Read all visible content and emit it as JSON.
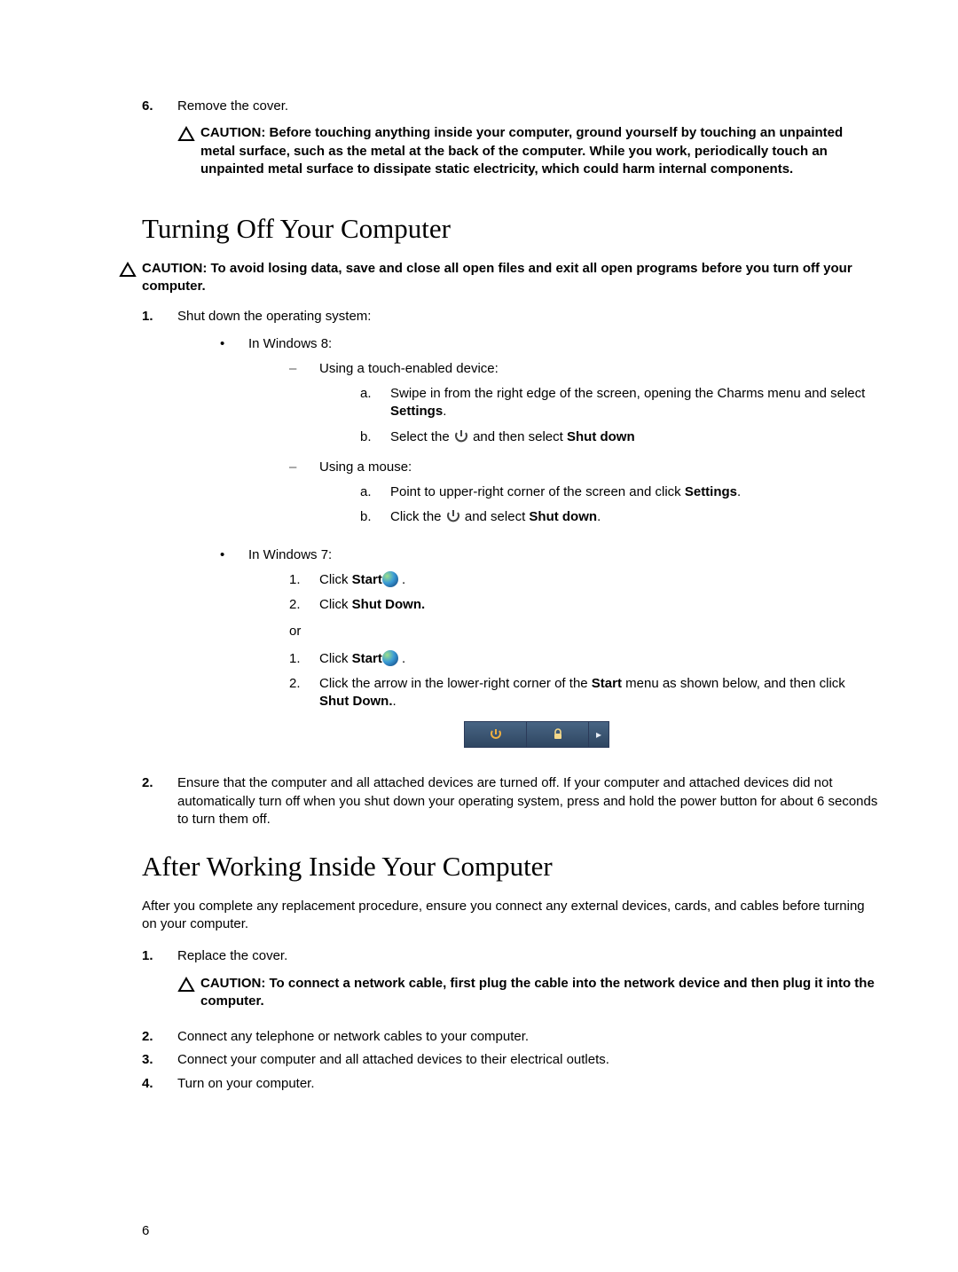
{
  "step6": {
    "num": "6.",
    "text": "Remove the cover.",
    "caution": "CAUTION: Before touching anything inside your computer, ground yourself by touching an unpainted metal surface, such as the metal at the back of the computer. While you work, periodically touch an unpainted metal surface to dissipate static electricity, which could harm internal components."
  },
  "section1": {
    "heading": "Turning Off Your Computer",
    "top_caution": "CAUTION: To avoid losing data, save and close all open files and exit all open programs before you turn off your computer.",
    "step1_num": "1.",
    "step1_text": "Shut down the operating system:",
    "win8_label": "In Windows 8:",
    "touch_label": "Using a touch-enabled device:",
    "touch_a_pre": "Swipe in from the right edge of the screen, opening the Charms menu and select ",
    "touch_a_bold": "Settings",
    "touch_a_post": ".",
    "touch_b_pre": "Select the ",
    "touch_b_mid": " and then select ",
    "touch_b_bold": "Shut down",
    "mouse_label": "Using a mouse:",
    "mouse_a_pre": "Point to upper-right corner of the screen and click ",
    "mouse_a_bold": "Settings",
    "mouse_a_post": ".",
    "mouse_b_pre": "Click the ",
    "mouse_b_mid": " and select ",
    "mouse_b_bold": "Shut down",
    "mouse_b_post": ".",
    "win7_label": "In Windows 7:",
    "win7_1_pre": "Click ",
    "win7_1_start": "Start",
    "win7_1_post": " .",
    "win7_2_pre": "Click ",
    "win7_2_bold": "Shut Down.",
    "or": "or",
    "win7_alt1_pre": "Click ",
    "win7_alt1_start": "Start",
    "win7_alt1_post": " .",
    "win7_alt2_pre": "Click the arrow in the lower-right corner of the ",
    "win7_alt2_start": "Start",
    "win7_alt2_mid": " menu as shown below, and then click ",
    "win7_alt2_bold": "Shut Down.",
    "win7_alt2_post": ".",
    "step2_num": "2.",
    "step2_text": "Ensure that the computer and all attached devices are turned off. If your computer and attached devices did not automatically turn off when you shut down your operating system, press and hold the power button for about 6 seconds to turn them off.",
    "letters": {
      "a": "a.",
      "b": "b."
    },
    "nums": {
      "n1": "1.",
      "n2": "2."
    }
  },
  "section2": {
    "heading": "After Working Inside Your Computer",
    "intro": "After you complete any replacement procedure, ensure you connect any external devices, cards, and cables before turning on your computer.",
    "s1_num": "1.",
    "s1_text": "Replace the cover.",
    "s1_caution": "CAUTION: To connect a network cable, first plug the cable into the network device and then plug it into the computer.",
    "s2_num": "2.",
    "s2_text": "Connect any telephone or network cables to your computer.",
    "s3_num": "3.",
    "s3_text": "Connect your computer and all attached devices to their electrical outlets.",
    "s4_num": "4.",
    "s4_text": "Turn on your computer."
  },
  "page_number": "6"
}
